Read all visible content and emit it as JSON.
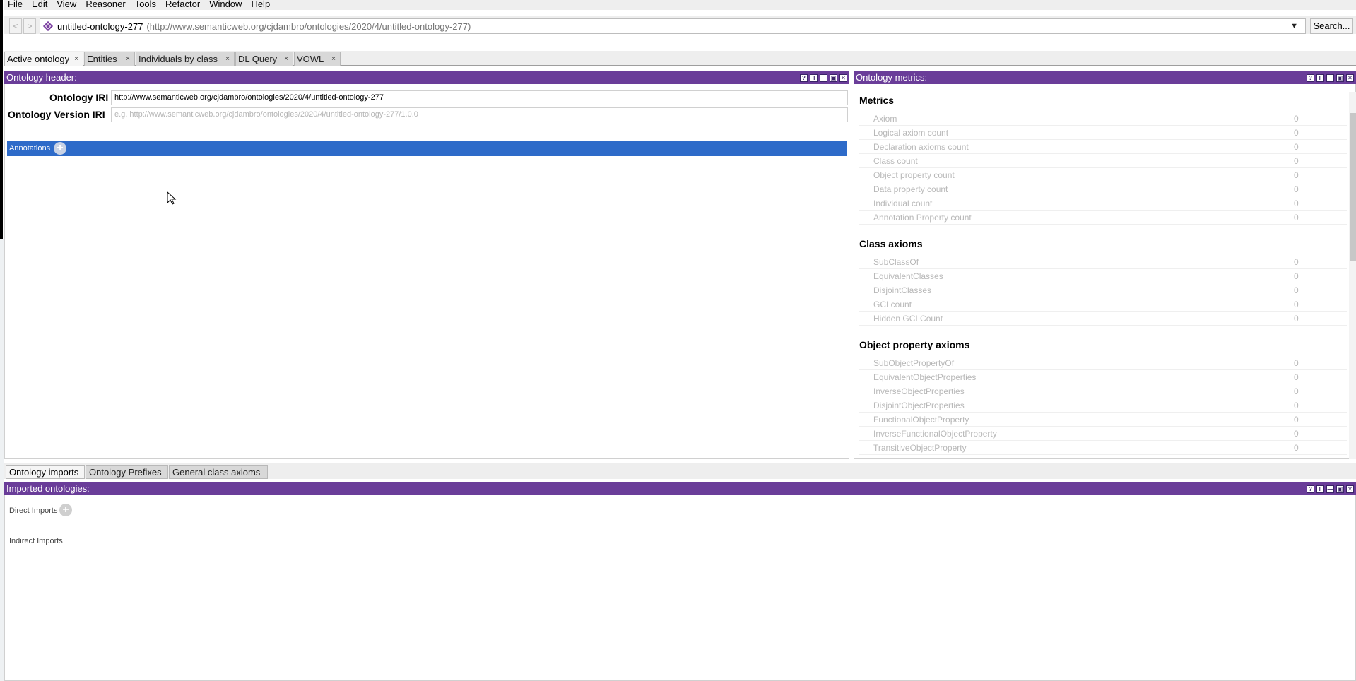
{
  "menubar": {
    "items": [
      "File",
      "Edit",
      "View",
      "Reasoner",
      "Tools",
      "Refactor",
      "Window",
      "Help"
    ]
  },
  "address": {
    "back": "<",
    "forward": ">",
    "ontology_name": "untitled-ontology-277",
    "ontology_iri": "(http://www.semanticweb.org/cjdambro/ontologies/2020/4/untitled-ontology-277)",
    "dropdown": "▼",
    "search_label": "Search..."
  },
  "tabs": [
    {
      "label": "Active ontology",
      "close": "×"
    },
    {
      "label": "Entities",
      "close": "×"
    },
    {
      "label": "Individuals by class",
      "close": "×"
    },
    {
      "label": "DL Query",
      "close": "×"
    },
    {
      "label": "VOWL",
      "close": "×"
    }
  ],
  "header_panel": {
    "title": "Ontology header:",
    "iri_label": "Ontology IRI",
    "iri_value": "http://www.semanticweb.org/cjdambro/ontologies/2020/4/untitled-ontology-277",
    "version_label": "Ontology Version IRI",
    "version_placeholder": "e.g. http://www.semanticweb.org/cjdambro/ontologies/2020/4/untitled-ontology-277/1.0.0",
    "annotations_label": "Annotations",
    "plus": "+"
  },
  "metrics_panel": {
    "title": "Ontology metrics:",
    "sections": [
      {
        "title": "Metrics",
        "rows": [
          {
            "label": "Axiom",
            "value": "0"
          },
          {
            "label": "Logical axiom count",
            "value": "0"
          },
          {
            "label": "Declaration axioms count",
            "value": "0"
          },
          {
            "label": "Class count",
            "value": "0"
          },
          {
            "label": "Object property count",
            "value": "0"
          },
          {
            "label": "Data property count",
            "value": "0"
          },
          {
            "label": "Individual count",
            "value": "0"
          },
          {
            "label": "Annotation Property count",
            "value": "0"
          }
        ]
      },
      {
        "title": "Class axioms",
        "rows": [
          {
            "label": "SubClassOf",
            "value": "0"
          },
          {
            "label": "EquivalentClasses",
            "value": "0"
          },
          {
            "label": "DisjointClasses",
            "value": "0"
          },
          {
            "label": "GCI count",
            "value": "0"
          },
          {
            "label": "Hidden GCI Count",
            "value": "0"
          }
        ]
      },
      {
        "title": "Object property axioms",
        "rows": [
          {
            "label": "SubObjectPropertyOf",
            "value": "0"
          },
          {
            "label": "EquivalentObjectProperties",
            "value": "0"
          },
          {
            "label": "InverseObjectProperties",
            "value": "0"
          },
          {
            "label": "DisjointObjectProperties",
            "value": "0"
          },
          {
            "label": "FunctionalObjectProperty",
            "value": "0"
          },
          {
            "label": "InverseFunctionalObjectProperty",
            "value": "0"
          },
          {
            "label": "TransitiveObjectProperty",
            "value": "0"
          }
        ]
      }
    ]
  },
  "bottom_tabs": [
    "Ontology imports",
    "Ontology Prefixes",
    "General class axioms"
  ],
  "imports_panel": {
    "title": "Imported ontologies:",
    "direct_label": "Direct Imports",
    "indirect_label": "Indirect Imports",
    "plus": "+"
  },
  "panel_buttons": [
    "?",
    "‖",
    "—",
    "▣",
    "✕"
  ],
  "colors": {
    "panel_header": "#6a3d99",
    "annotations_bar": "#2e6bc9"
  }
}
